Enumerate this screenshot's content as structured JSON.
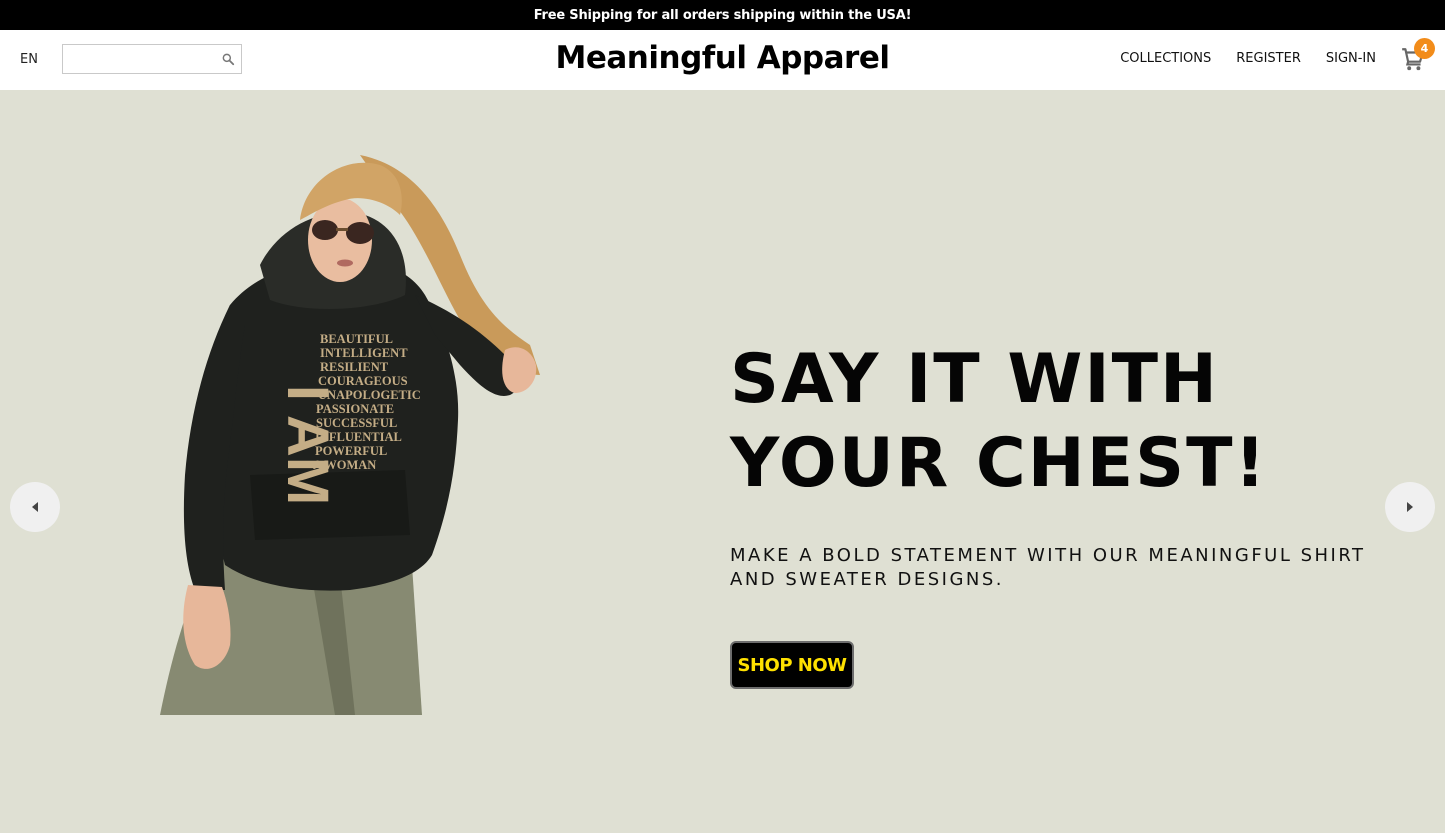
{
  "announcement": {
    "text": "Free Shipping for all orders shipping within the USA!"
  },
  "header": {
    "language": "EN",
    "search": {
      "placeholder": "",
      "value": "",
      "icon": "search-icon"
    },
    "brand": "Meaningful Apparel",
    "nav": [
      {
        "label": "COLLECTIONS"
      },
      {
        "label": "REGISTER"
      },
      {
        "label": "SIGN-IN"
      }
    ],
    "cart": {
      "icon": "cart-icon",
      "count": "4"
    }
  },
  "hero": {
    "headline": "SAY IT WITH YOUR CHEST!",
    "subheadline": "MAKE A BOLD STATEMENT WITH OUR MEANINGFUL SHIRT AND SWEATER DESIGNS.",
    "cta_label": "SHOP NOW",
    "hoodie_print": {
      "big": "I AM",
      "words": [
        "BEAUTIFUL",
        "INTELLIGENT",
        "RESILIENT",
        "COURAGEOUS",
        "UNAPOLOGETIC",
        "PASSIONATE",
        "SUCCESSFUL",
        "INFLUENTIAL",
        "POWERFUL",
        "A WOMAN"
      ]
    },
    "prev_icon": "chevron-left-icon",
    "next_icon": "chevron-right-icon"
  },
  "colors": {
    "announcement_bg": "#000000",
    "hero_bg": "#dfe0d3",
    "cta_text": "#ffe100",
    "cart_badge": "#f28c1a"
  }
}
